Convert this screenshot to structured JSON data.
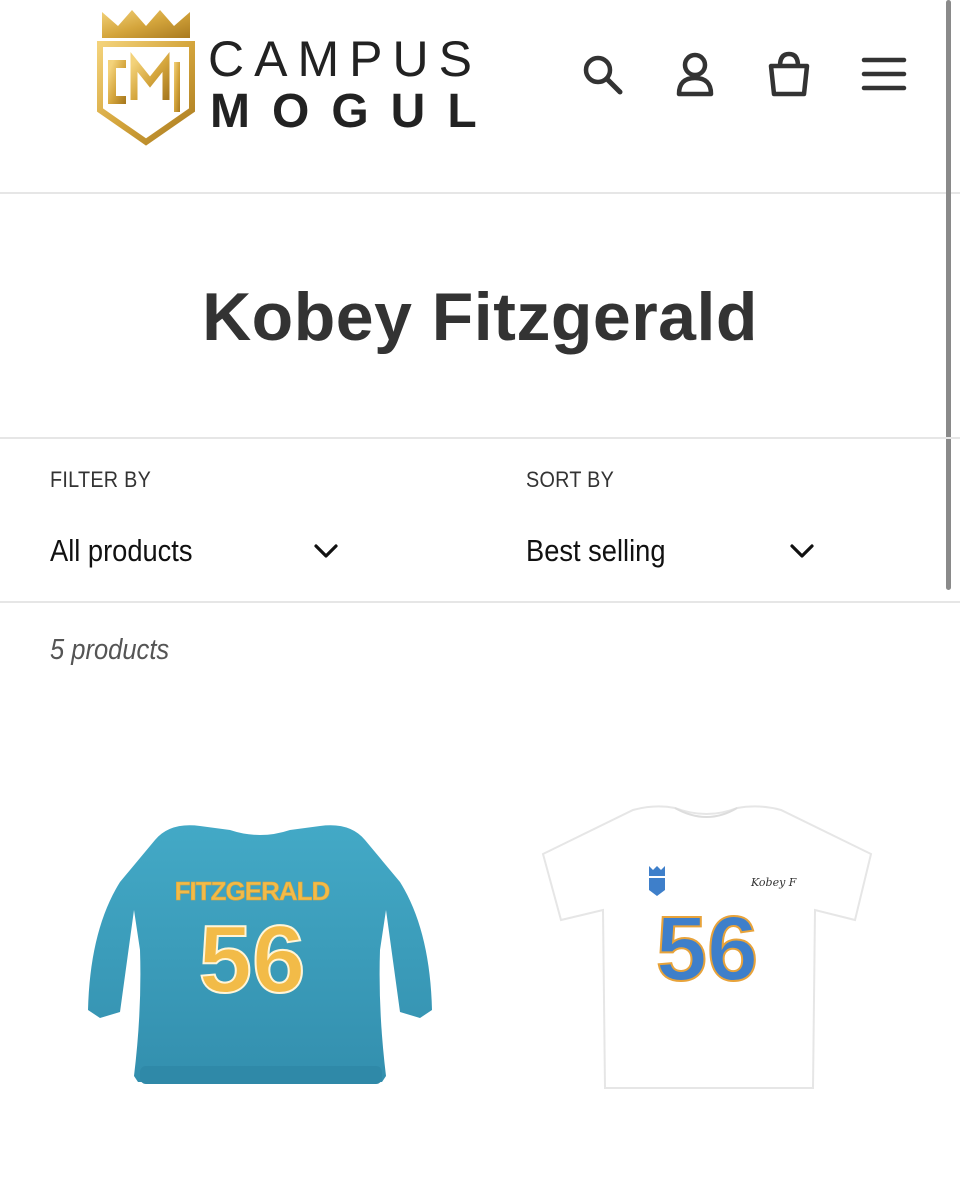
{
  "header": {
    "logo_line1": "CAMPUS",
    "logo_line2": "MOGUL",
    "logo_monogram": "CM",
    "icons": [
      "search-icon",
      "account-icon",
      "cart-icon",
      "menu-icon"
    ]
  },
  "collection": {
    "title": "Kobey Fitzgerald"
  },
  "filter": {
    "label": "FILTER BY",
    "value": "All products"
  },
  "sort": {
    "label": "SORT BY",
    "value": "Best selling"
  },
  "product_count": "5 products",
  "products": [
    {
      "name_print": "FITZGERALD",
      "number_print": "56",
      "color": "#3a9fbd",
      "print_color": "#f2bb48"
    },
    {
      "number_print": "56",
      "signature": "Kobey F",
      "color": "#ffffff",
      "print_color": "#3e7fca"
    }
  ],
  "colors": {
    "logo_gold": "#d4a53c",
    "text_dark": "#333333",
    "divider": "#e6e6e6"
  }
}
